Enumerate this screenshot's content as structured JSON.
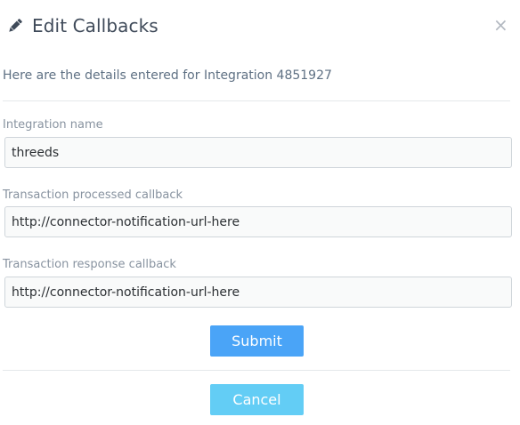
{
  "dialog": {
    "title": "Edit Callbacks",
    "close_label": "×",
    "subtitle": "Here are the details entered for Integration 4851927"
  },
  "form": {
    "integration_name": {
      "label": "Integration name",
      "value": "threeds"
    },
    "processed_callback": {
      "label": "Transaction processed callback",
      "value": "http://connector-notification-url-here"
    },
    "response_callback": {
      "label": "Transaction response callback",
      "value": "http://connector-notification-url-here"
    }
  },
  "actions": {
    "submit_label": "Submit",
    "cancel_label": "Cancel"
  },
  "icons": {
    "title_icon": "pencil-icon",
    "close_icon": "close-icon"
  },
  "colors": {
    "submit": "#4aa4f7",
    "cancel": "#63cdf5"
  }
}
